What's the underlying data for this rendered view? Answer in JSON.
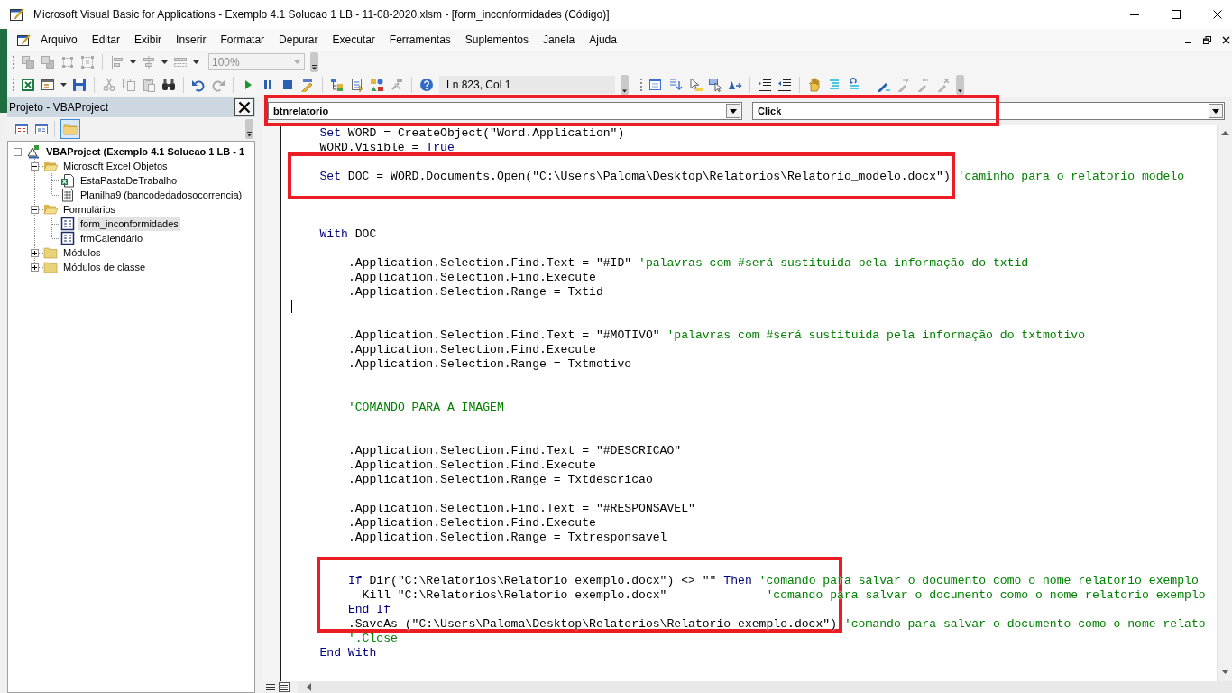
{
  "window": {
    "title": "Microsoft Visual Basic for Applications - Exemplo 4.1 Solucao 1 LB - 11-08-2020.xlsm - [form_inconformidades (Código)]"
  },
  "menu": [
    "Arquivo",
    "Editar",
    "Exibir",
    "Inserir",
    "Formatar",
    "Depurar",
    "Executar",
    "Ferramentas",
    "Suplementos",
    "Janela",
    "Ajuda"
  ],
  "toolbar": {
    "zoom": {
      "value": "100%",
      "disabled": true
    },
    "position": "Ln 823, Col 1"
  },
  "project_panel": {
    "title": "Projeto - VBAProject",
    "folders_toggle": {
      "pressed": true
    },
    "tree": [
      {
        "kind": "project",
        "label": "VBAProject (Exemplo 4.1 Solucao 1 LB - 1",
        "expanded": true,
        "selected": false,
        "children": [
          {
            "kind": "folder",
            "label": "Microsoft Excel Objetos",
            "expanded": true,
            "selected": false,
            "children": [
              {
                "kind": "workbook",
                "label": "EstaPastaDeTrabalho",
                "selected": false
              },
              {
                "kind": "sheet",
                "label": "Planilha9 (bancodedadosocorrencia)",
                "selected": false
              }
            ]
          },
          {
            "kind": "folder",
            "label": "Formulários",
            "expanded": true,
            "selected": false,
            "children": [
              {
                "kind": "form",
                "label": "form_inconformidades",
                "selected": true
              },
              {
                "kind": "form",
                "label": "frmCalendário",
                "selected": false
              }
            ]
          },
          {
            "kind": "folder",
            "label": "Módulos",
            "expanded": false,
            "selected": false
          },
          {
            "kind": "folder",
            "label": "Módulos de classe",
            "expanded": false,
            "selected": false
          }
        ]
      }
    ]
  },
  "code_window": {
    "object": "btnrelatorio",
    "procedure": "Click",
    "selectors_highlighted": true,
    "blocks": [
      {
        "highlighted": false,
        "lines": [
          {
            "kind": "code",
            "segments": [
              {
                "kind": "keyword",
                "text": "    Set"
              },
              {
                "kind": "plain",
                "text": " WORD = CreateObject(\"Word.Application\")"
              }
            ]
          },
          {
            "kind": "code",
            "segments": [
              {
                "kind": "plain",
                "text": "    WORD.Visible = "
              },
              {
                "kind": "keyword",
                "text": "True"
              }
            ]
          }
        ]
      },
      {
        "highlighted": true,
        "lines": [
          {
            "kind": "blank"
          },
          {
            "kind": "code",
            "segments": [
              {
                "kind": "keyword",
                "text": "    Set"
              },
              {
                "kind": "plain",
                "text": " DOC = WORD.Documents.Open(\"C:\\Users\\Paloma\\Desktop\\Relatorios\\Relatorio_modelo.docx\") "
              },
              {
                "kind": "comment",
                "text": "'caminho para o relatorio modelo"
              }
            ]
          },
          {
            "kind": "blank"
          }
        ]
      },
      {
        "highlighted": false,
        "lines": [
          {
            "kind": "blank"
          },
          {
            "kind": "blank"
          },
          {
            "kind": "code",
            "segments": [
              {
                "kind": "keyword",
                "text": "    With"
              },
              {
                "kind": "plain",
                "text": " DOC"
              }
            ]
          },
          {
            "kind": "blank"
          },
          {
            "kind": "code",
            "segments": [
              {
                "kind": "plain",
                "text": "        .Application.Selection.Find.Text = \"#ID\" "
              },
              {
                "kind": "comment",
                "text": "'palavras com #será sustituida pela informação do txtid"
              }
            ]
          },
          {
            "kind": "code",
            "segments": [
              {
                "kind": "plain",
                "text": "        .Application.Selection.Find.Execute"
              }
            ]
          },
          {
            "kind": "code",
            "segments": [
              {
                "kind": "plain",
                "text": "        .Application.Selection.Range = Txtid"
              }
            ]
          },
          {
            "kind": "caret"
          },
          {
            "kind": "blank"
          },
          {
            "kind": "code",
            "segments": [
              {
                "kind": "plain",
                "text": "        .Application.Selection.Find.Text = \"#MOTIVO\" "
              },
              {
                "kind": "comment",
                "text": "'palavras com #será sustituida pela informação do txtmotivo"
              }
            ]
          },
          {
            "kind": "code",
            "segments": [
              {
                "kind": "plain",
                "text": "        .Application.Selection.Find.Execute"
              }
            ]
          },
          {
            "kind": "code",
            "segments": [
              {
                "kind": "plain",
                "text": "        .Application.Selection.Range = Txtmotivo"
              }
            ]
          },
          {
            "kind": "blank"
          },
          {
            "kind": "blank"
          },
          {
            "kind": "code",
            "segments": [
              {
                "kind": "comment",
                "text": "        'COMANDO PARA A IMAGEM"
              }
            ]
          },
          {
            "kind": "blank"
          },
          {
            "kind": "blank"
          },
          {
            "kind": "code",
            "segments": [
              {
                "kind": "plain",
                "text": "        .Application.Selection.Find.Text = \"#DESCRICAO\""
              }
            ]
          },
          {
            "kind": "code",
            "segments": [
              {
                "kind": "plain",
                "text": "        .Application.Selection.Find.Execute"
              }
            ]
          },
          {
            "kind": "code",
            "segments": [
              {
                "kind": "plain",
                "text": "        .Application.Selection.Range = Txtdescricao"
              }
            ]
          },
          {
            "kind": "blank"
          },
          {
            "kind": "code",
            "segments": [
              {
                "kind": "plain",
                "text": "        .Application.Selection.Find.Text = \"#RESPONSAVEL\""
              }
            ]
          },
          {
            "kind": "code",
            "segments": [
              {
                "kind": "plain",
                "text": "        .Application.Selection.Find.Execute"
              }
            ]
          },
          {
            "kind": "code",
            "segments": [
              {
                "kind": "plain",
                "text": "        .Application.Selection.Range = Txtresponsavel"
              }
            ]
          },
          {
            "kind": "blank"
          }
        ]
      },
      {
        "highlighted": true,
        "lines": [
          {
            "kind": "blank"
          },
          {
            "kind": "code",
            "segments": [
              {
                "kind": "keyword",
                "text": "        If"
              },
              {
                "kind": "plain",
                "text": " Dir(\"C:\\Relatorios\\Relatorio exemplo.docx\") <> \"\" "
              },
              {
                "kind": "keyword",
                "text": "Then"
              },
              {
                "kind": "comment",
                "text": " 'comando para salvar o documento como o nome relatorio exemplo"
              }
            ]
          },
          {
            "kind": "code",
            "segments": [
              {
                "kind": "plain",
                "text": "          Kill \"C:\\Relatorios\\Relatorio exemplo.docx\"              "
              },
              {
                "kind": "comment",
                "text": "'comando para salvar o documento como o nome relatorio exemplo"
              }
            ]
          },
          {
            "kind": "code",
            "segments": [
              {
                "kind": "keyword",
                "text": "        End If"
              }
            ]
          },
          {
            "kind": "code",
            "segments": [
              {
                "kind": "plain",
                "text": "        .SaveAs (\"C:\\Users\\Paloma\\Desktop\\Relatorios\\Relatorio exemplo.docx\") "
              },
              {
                "kind": "comment",
                "text": "'comando para salvar o documento como o nome relato"
              }
            ]
          }
        ]
      },
      {
        "highlighted": false,
        "lines": [
          {
            "kind": "code",
            "segments": [
              {
                "kind": "comment",
                "text": "        '.Close"
              }
            ]
          },
          {
            "kind": "code",
            "segments": [
              {
                "kind": "keyword",
                "text": "    End With"
              }
            ]
          }
        ]
      }
    ]
  }
}
